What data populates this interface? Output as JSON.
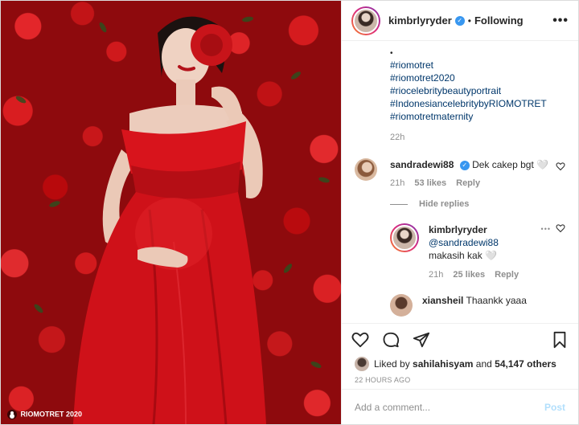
{
  "post": {
    "username": "kimbrlyryder",
    "separator": "•",
    "follow_status": "Following",
    "more_label": "•••",
    "verified_glyph": "✓",
    "photo_tag": "RIOMOTRET 2020"
  },
  "caption": {
    "bullet": "•",
    "hashtags": [
      "#riomotret",
      "#riomotret2020",
      "#riocelebritybeautyportrait",
      "#IndonesiancelebritybyRIOMOTRET",
      "#riomotretmaternity"
    ],
    "time": "22h"
  },
  "comments": [
    {
      "username": "sandradewi88",
      "verified": true,
      "text": "Dek cakep bgt 🤍",
      "time": "21h",
      "likes": "53 likes",
      "reply_label": "Reply"
    }
  ],
  "hide_replies_label": "Hide replies",
  "replies": [
    {
      "username": "kimbrlyryder",
      "mention": "@sandradewi88",
      "text": " makasih kak 🤍",
      "time": "21h",
      "likes": "25 likes",
      "reply_label": "Reply"
    },
    {
      "username": "xiansheil",
      "text": "Thaankk yaaa"
    }
  ],
  "likes_line": {
    "prefix": "Liked by ",
    "user": "sahilahisyam",
    "middle": " and ",
    "count": "54,147 others"
  },
  "timestamp": "22 HOURS AGO",
  "add_comment": {
    "placeholder": "Add a comment...",
    "post_label": "Post"
  },
  "colors": {
    "link": "#00376b",
    "verified": "#3897f0",
    "muted": "#8e8e8e",
    "post_disabled": "#b2dffc"
  }
}
